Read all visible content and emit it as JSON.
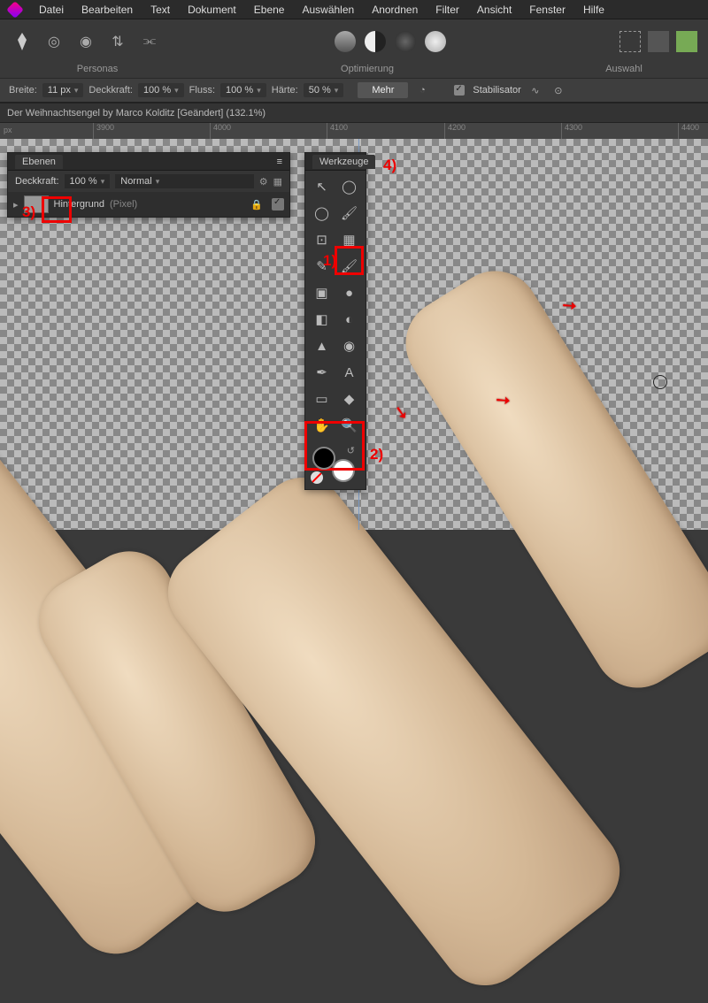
{
  "menu": [
    "Datei",
    "Bearbeiten",
    "Text",
    "Dokument",
    "Ebene",
    "Auswählen",
    "Anordnen",
    "Filter",
    "Ansicht",
    "Fenster",
    "Hilfe"
  ],
  "toolbar_labels": {
    "personas": "Personas",
    "optimize": "Optimierung",
    "selection": "Auswahl"
  },
  "options": {
    "width_label": "Breite:",
    "width_value": "11 px",
    "opacity_label": "Deckkraft:",
    "opacity_value": "100 %",
    "flow_label": "Fluss:",
    "flow_value": "100 %",
    "hardness_label": "Härte:",
    "hardness_value": "50 %",
    "more": "Mehr",
    "stabilizer": "Stabilisator"
  },
  "document_tab": "Der Weihnachtsengel by Marco Kolditz [Geändert] (132.1%)",
  "ruler": {
    "unit": "px",
    "ticks": [
      "3900",
      "4000",
      "4100",
      "4200",
      "4300",
      "4400"
    ]
  },
  "layers_panel": {
    "title": "Ebenen",
    "opacity_label": "Deckkraft:",
    "opacity_value": "100 %",
    "blend": "Normal",
    "layer_name": "Hintergrund",
    "layer_type": "(Pixel)"
  },
  "tools_panel": {
    "title": "Werkzeuge"
  },
  "tools_list": [
    "move-tool",
    "freehand-select-tool",
    "ellipse-select-tool",
    "brush-tool",
    "crop-tool",
    "gradient-tool",
    "pen-tool",
    "paint-brush-tool",
    "fill-tool",
    "clone-tool",
    "eraser-tool",
    "smudge-tool",
    "burn-tool",
    "color-picker-tool",
    "vector-pen-tool",
    "text-tool",
    "rectangle-tool",
    "shape-tool",
    "hand-tool",
    "zoom-tool"
  ],
  "tool_glyphs": [
    "↖",
    "◯",
    "◯",
    "🖌",
    "⊡",
    "▦",
    "✎",
    "🖌",
    "▣",
    "●",
    "◧",
    "◐",
    "▲",
    "◉",
    "✒",
    "A",
    "▭",
    "◆",
    "✋",
    "🔍"
  ],
  "annotations": {
    "n1": "1)",
    "n2": "2)",
    "n3": "3)",
    "n4": "4)"
  }
}
